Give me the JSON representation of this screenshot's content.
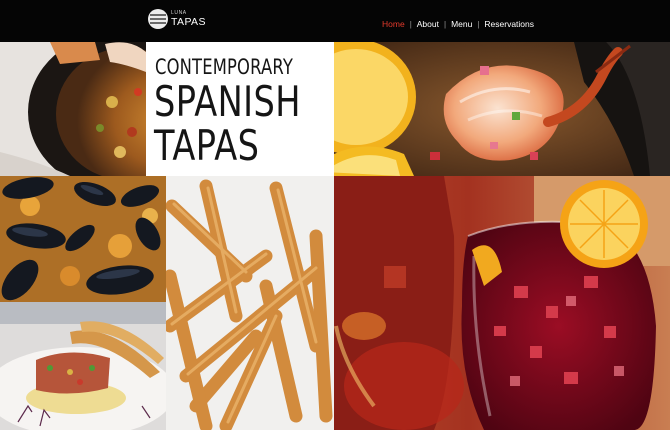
{
  "header": {
    "logo": {
      "small_text": "LUNA",
      "big_text": "TAPAS",
      "icon": "logo-icon"
    },
    "nav": [
      {
        "label": "Home",
        "active": true
      },
      {
        "label": "About",
        "active": false
      },
      {
        "label": "Menu",
        "active": false
      },
      {
        "label": "Reservations",
        "active": false
      }
    ],
    "separator": "|"
  },
  "hero": {
    "line1": "CONTEMPORARY",
    "line2": "SPANISH",
    "line3": "TAPAS"
  },
  "colors": {
    "header_bg": "#050505",
    "nav_active": "#e33a2c",
    "nav_text": "#ffffff",
    "hero_text": "#151515"
  }
}
